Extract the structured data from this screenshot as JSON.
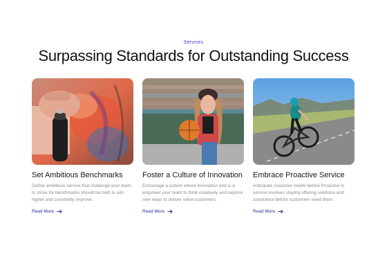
{
  "section": {
    "label": "Services",
    "title": "Surpassing Standards for Outstanding Success"
  },
  "cards": [
    {
      "title": "Set Ambitious Benchmarks",
      "text": "Define ambitious service that challenge your team to strive for benchmarks should be both to aim higher and constantly improve.",
      "link": "Read More",
      "icon": "arrow-right-icon"
    },
    {
      "title": "Foster a Culture of Innovation",
      "text": "Encourage a culture where innovation and is a empower your team to think creatively and explore new ways to deliver value customers.",
      "link": "Read More",
      "icon": "arrow-right-icon"
    },
    {
      "title": "Embrace Proactive Service",
      "text": "Anticipate customer needs before Proactive is service involves staying offering solutions and assistance before customers need them.",
      "link": "Read More",
      "icon": "arrow-right-icon"
    }
  ],
  "colors": {
    "accent": "#3b3bd6",
    "link": "#2a2a9e",
    "title": "#111111",
    "body_text": "#8a8a8a"
  }
}
